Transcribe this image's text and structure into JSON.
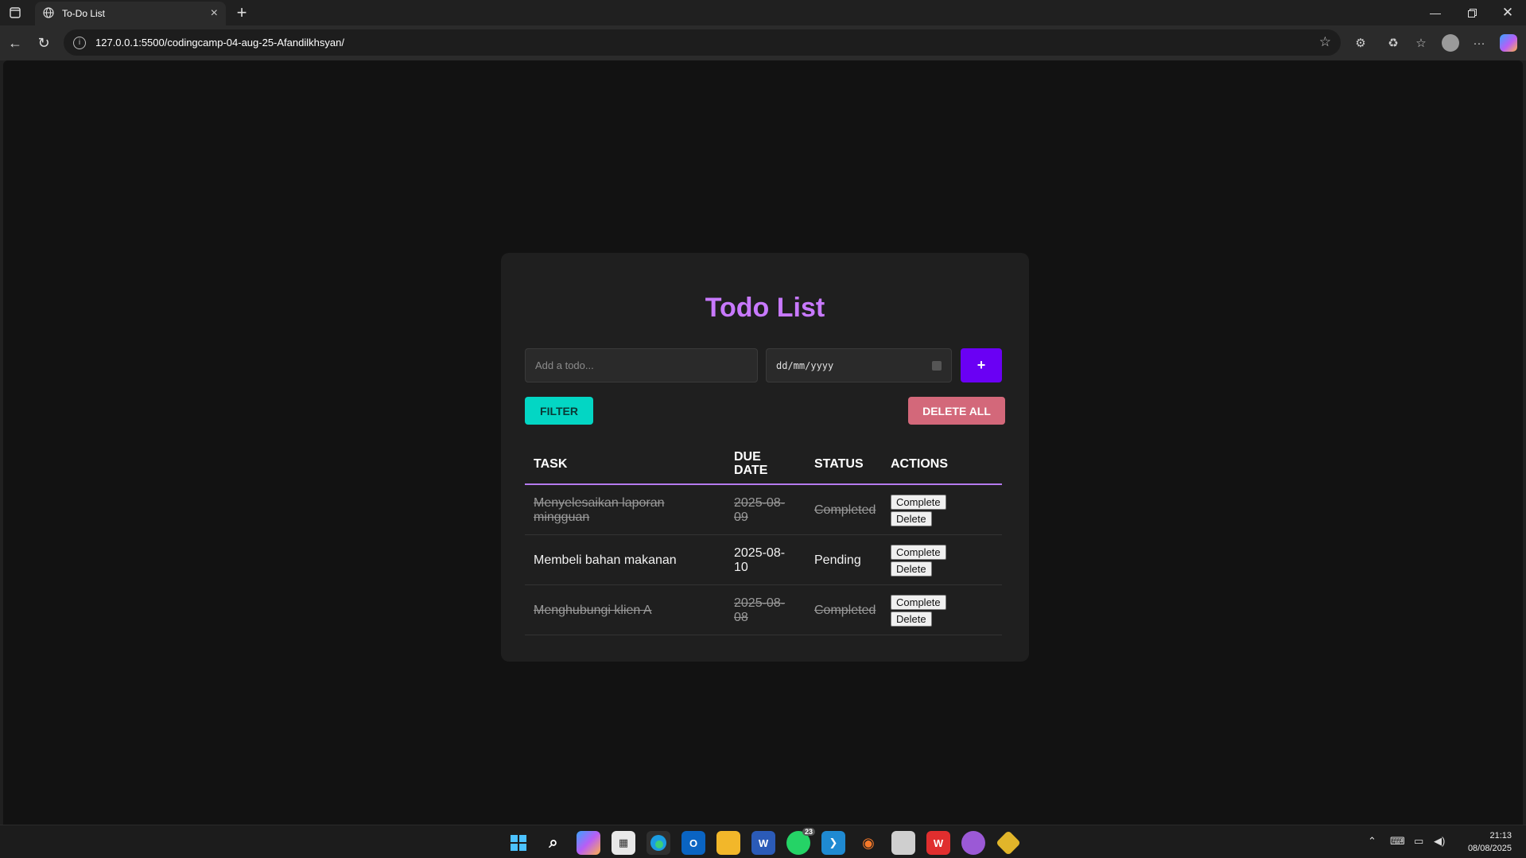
{
  "browser": {
    "tab_title": "To-Do List",
    "tab_close": "×",
    "new_tab": "+",
    "url": "127.0.0.1:5500/codingcamp-04-aug-25-Afandilkhsyan/"
  },
  "app": {
    "title": "Todo List",
    "todo_placeholder": "Add a todo...",
    "date_placeholder": "dd/mm/yyyy",
    "add_label": "+",
    "filter_label": "FILTER",
    "delete_all_label": "DELETE ALL",
    "accent_color": "#c879ff",
    "columns": {
      "task": "TASK",
      "due_date_1": "DUE",
      "due_date_2": "DATE",
      "status": "STATUS",
      "actions": "ACTIONS"
    },
    "todos": [
      {
        "task_1": "Menyelesaikan laporan",
        "task_2": "mingguan",
        "date_1": "2025-08-",
        "date_2": "09",
        "status": "Completed",
        "complete_label": "Complete",
        "delete_label": "Delete"
      },
      {
        "task_1": "Membeli bahan makanan",
        "task_2": "",
        "date_1": "2025-08-",
        "date_2": "10",
        "status": "Pending",
        "complete_label": "Complete",
        "delete_label": "Delete"
      },
      {
        "task_1": "Menghubungi klien A",
        "task_2": "",
        "date_1": "2025-08-",
        "date_2": "08",
        "status": "Completed",
        "complete_label": "Complete",
        "delete_label": "Delete"
      }
    ]
  },
  "taskbar": {
    "whatsapp_badge": "23",
    "time": "21:13",
    "date": "08/08/2025"
  }
}
